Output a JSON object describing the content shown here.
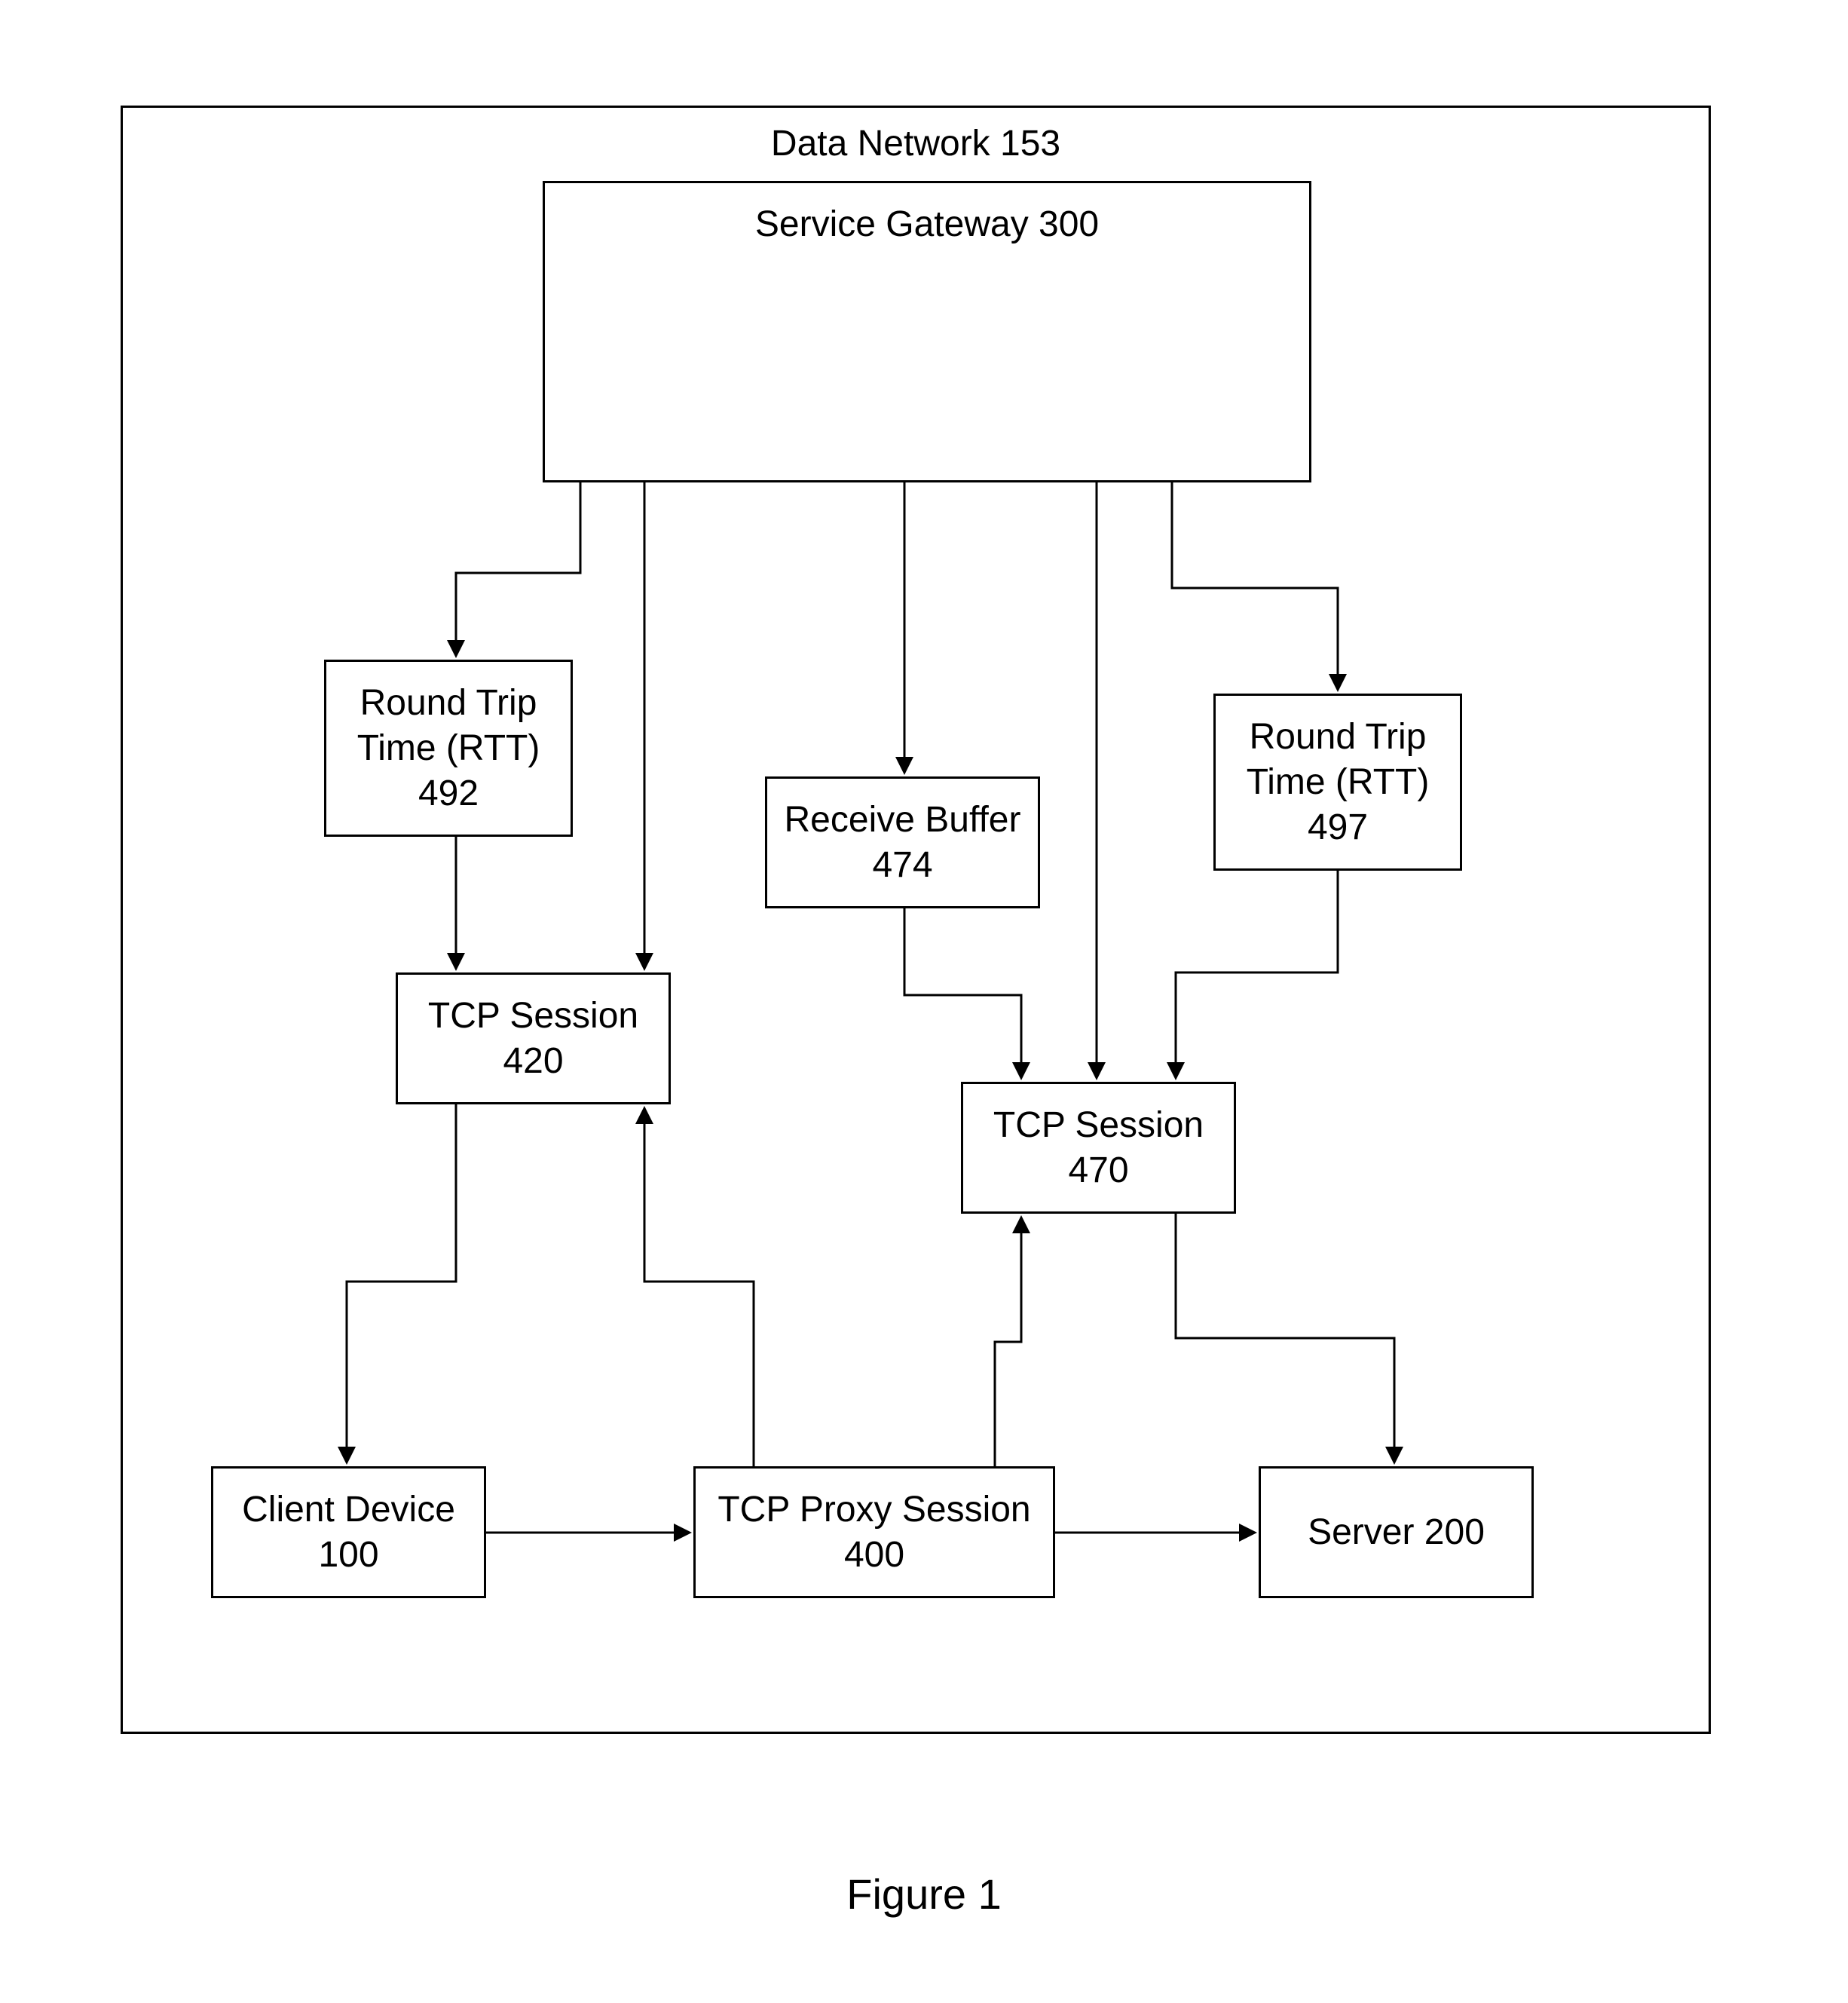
{
  "diagram": {
    "container_title": "Data Network 153",
    "nodes": {
      "service_gateway": {
        "label": "Service Gateway 300"
      },
      "rtt_left": {
        "line1": "Round Trip",
        "line2": "Time (RTT)",
        "num": "492"
      },
      "receive_buffer": {
        "line1": "Receive Buffer",
        "num": "474"
      },
      "rtt_right": {
        "line1": "Round Trip",
        "line2": "Time (RTT)",
        "num": "497"
      },
      "tcp_session_left": {
        "line1": "TCP Session",
        "num": "420"
      },
      "tcp_session_right": {
        "line1": "TCP Session",
        "num": "470"
      },
      "client_device": {
        "line1": "Client Device",
        "num": "100"
      },
      "tcp_proxy": {
        "line1": "TCP Proxy Session",
        "num": "400"
      },
      "server": {
        "label": "Server 200"
      }
    },
    "caption": "Figure 1"
  }
}
